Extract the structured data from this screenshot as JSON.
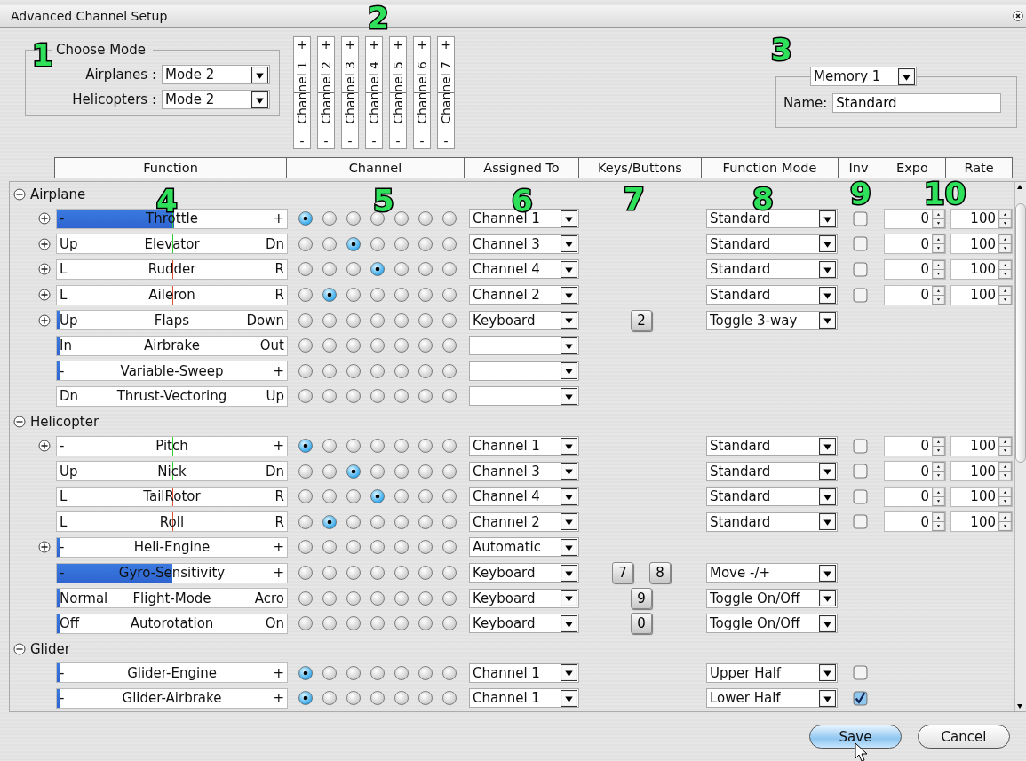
{
  "window": {
    "title": "Advanced Channel Setup"
  },
  "callouts": [
    "1",
    "2",
    "3",
    "4",
    "5",
    "6",
    "7",
    "8",
    "9",
    "10"
  ],
  "mode_group": {
    "legend": "Choose Mode",
    "fields": [
      {
        "label": "Airplanes :",
        "value": "Mode 2"
      },
      {
        "label": "Helicopters :",
        "value": "Mode 2"
      }
    ]
  },
  "channel_headers": [
    {
      "plus": "+",
      "label": "Channel 1",
      "minus": "-"
    },
    {
      "plus": "+",
      "label": "Channel 2",
      "minus": "-"
    },
    {
      "plus": "+",
      "label": "Channel 3",
      "minus": "-"
    },
    {
      "plus": "+",
      "label": "Channel 4",
      "minus": "-"
    },
    {
      "plus": "+",
      "label": "Channel 5",
      "minus": "-"
    },
    {
      "plus": "+",
      "label": "Channel 6",
      "minus": "-"
    },
    {
      "plus": "+",
      "label": "Channel 7",
      "minus": "-"
    }
  ],
  "memory": {
    "selector": "Memory 1",
    "name_label": "Name:",
    "name_value": "Standard"
  },
  "columns": [
    "Function",
    "Channel",
    "Assigned To",
    "Keys/Buttons",
    "Function Mode",
    "Inv",
    "Expo",
    "Rate"
  ],
  "sections": [
    {
      "label": "Airplane",
      "expanded": true,
      "rows": [
        {
          "expandable": true,
          "left": "-",
          "name": "Throttle",
          "right": "+",
          "level": 0.51,
          "color": "#33cc33",
          "channels": [
            {
              "selected": true
            },
            {
              "selected": false
            },
            {
              "selected": false
            },
            {
              "selected": false
            },
            {
              "selected": false
            },
            {
              "selected": false
            },
            {
              "selected": false
            }
          ],
          "assigned": "Channel 1",
          "mode": "Standard",
          "inverted": false,
          "expo": "0",
          "rate": "100"
        },
        {
          "expandable": true,
          "left": "Up",
          "name": "Elevator",
          "right": "Dn",
          "color": "#33cc33",
          "channels": [
            {
              "selected": false
            },
            {
              "selected": false
            },
            {
              "selected": true
            },
            {
              "selected": false
            },
            {
              "selected": false
            },
            {
              "selected": false
            },
            {
              "selected": false
            }
          ],
          "assigned": "Channel 3",
          "mode": "Standard",
          "inverted": false,
          "expo": "0",
          "rate": "100"
        },
        {
          "expandable": true,
          "left": "L",
          "name": "Rudder",
          "right": "R",
          "color": "#e05030",
          "channels": [
            {
              "selected": false
            },
            {
              "selected": false
            },
            {
              "selected": false
            },
            {
              "selected": true
            },
            {
              "selected": false
            },
            {
              "selected": false
            },
            {
              "selected": false
            }
          ],
          "assigned": "Channel 4",
          "mode": "Standard",
          "inverted": false,
          "expo": "0",
          "rate": "100"
        },
        {
          "expandable": true,
          "left": "L",
          "name": "Aileron",
          "right": "R",
          "color": "#e05030",
          "channels": [
            {
              "selected": false
            },
            {
              "selected": true
            },
            {
              "selected": false
            },
            {
              "selected": false
            },
            {
              "selected": false
            },
            {
              "selected": false
            },
            {
              "selected": false
            }
          ],
          "assigned": "Channel 2",
          "mode": "Standard",
          "inverted": false,
          "expo": "0",
          "rate": "100"
        },
        {
          "expandable": true,
          "left": "Up",
          "name": "Flaps",
          "right": "Down",
          "level": 0.01,
          "channels": [
            {
              "selected": false
            },
            {
              "selected": false
            },
            {
              "selected": false
            },
            {
              "selected": false
            },
            {
              "selected": false
            },
            {
              "selected": false
            },
            {
              "selected": false
            }
          ],
          "assigned": "Keyboard",
          "keys": [
            "2"
          ],
          "mode": "Toggle 3-way"
        },
        {
          "left": "In",
          "name": "Airbrake",
          "right": "Out",
          "level": 0.01,
          "channels": [
            {
              "selected": false
            },
            {
              "selected": false
            },
            {
              "selected": false
            },
            {
              "selected": false
            },
            {
              "selected": false
            },
            {
              "selected": false
            },
            {
              "selected": false
            }
          ]
        },
        {
          "left": "-",
          "name": "Variable-Sweep",
          "right": "+",
          "level": 0.01,
          "channels": [
            {
              "selected": false
            },
            {
              "selected": false
            },
            {
              "selected": false
            },
            {
              "selected": false
            },
            {
              "selected": false
            },
            {
              "selected": false
            },
            {
              "selected": false
            }
          ]
        },
        {
          "left": "Dn",
          "name": "Thrust-Vectoring",
          "right": "Up",
          "channels": [
            {
              "selected": false
            },
            {
              "selected": false
            },
            {
              "selected": false
            },
            {
              "selected": false
            },
            {
              "selected": false
            },
            {
              "selected": false
            },
            {
              "selected": false
            }
          ]
        }
      ]
    },
    {
      "label": "Helicopter",
      "expanded": true,
      "rows": [
        {
          "expandable": true,
          "left": "-",
          "name": "Pitch",
          "right": "+",
          "color": "#33cc33",
          "channels": [
            {
              "selected": true
            },
            {
              "selected": false
            },
            {
              "selected": false
            },
            {
              "selected": false
            },
            {
              "selected": false
            },
            {
              "selected": false
            },
            {
              "selected": false
            }
          ],
          "assigned": "Channel 1",
          "mode": "Standard",
          "inverted": false,
          "expo": "0",
          "rate": "100"
        },
        {
          "left": "Up",
          "name": "Nick",
          "right": "Dn",
          "color": "#33cc33",
          "channels": [
            {
              "selected": false
            },
            {
              "selected": false
            },
            {
              "selected": true
            },
            {
              "selected": false
            },
            {
              "selected": false
            },
            {
              "selected": false
            },
            {
              "selected": false
            }
          ],
          "assigned": "Channel 3",
          "mode": "Standard",
          "inverted": false,
          "expo": "0",
          "rate": "100"
        },
        {
          "left": "L",
          "name": "TailRotor",
          "right": "R",
          "color": "#e05030",
          "channels": [
            {
              "selected": false
            },
            {
              "selected": false
            },
            {
              "selected": false
            },
            {
              "selected": true
            },
            {
              "selected": false
            },
            {
              "selected": false
            },
            {
              "selected": false
            }
          ],
          "assigned": "Channel 4",
          "mode": "Standard",
          "inverted": false,
          "expo": "0",
          "rate": "100"
        },
        {
          "left": "L",
          "name": "Roll",
          "right": "R",
          "color": "#e05030",
          "channels": [
            {
              "selected": false
            },
            {
              "selected": true
            },
            {
              "selected": false
            },
            {
              "selected": false
            },
            {
              "selected": false
            },
            {
              "selected": false
            },
            {
              "selected": false
            }
          ],
          "assigned": "Channel 2",
          "mode": "Standard",
          "inverted": false,
          "expo": "0",
          "rate": "100"
        },
        {
          "expandable": true,
          "left": "-",
          "name": "Heli-Engine",
          "right": "+",
          "level": 0.01,
          "channels": [
            {
              "selected": false
            },
            {
              "selected": false
            },
            {
              "selected": false
            },
            {
              "selected": false
            },
            {
              "selected": false
            },
            {
              "selected": false
            },
            {
              "selected": false
            }
          ],
          "assigned": "Automatic"
        },
        {
          "left": "-",
          "name": "Gyro-Sensitivity",
          "right": "+",
          "level": 0.5,
          "channels": [
            {
              "selected": false
            },
            {
              "selected": false
            },
            {
              "selected": false
            },
            {
              "selected": false
            },
            {
              "selected": false
            },
            {
              "selected": false
            },
            {
              "selected": false
            }
          ],
          "assigned": "Keyboard",
          "keys": [
            "7",
            "8"
          ],
          "mode": "Move -/+"
        },
        {
          "left": "Normal",
          "name": "Flight-Mode",
          "right": "Acro",
          "level": 0.01,
          "channels": [
            {
              "selected": false
            },
            {
              "selected": false
            },
            {
              "selected": false
            },
            {
              "selected": false
            },
            {
              "selected": false
            },
            {
              "selected": false
            },
            {
              "selected": false
            }
          ],
          "assigned": "Keyboard",
          "keys": [
            "9"
          ],
          "mode": "Toggle On/Off"
        },
        {
          "left": "Off",
          "name": "Autorotation",
          "right": "On",
          "level": 0.01,
          "channels": [
            {
              "selected": false
            },
            {
              "selected": false
            },
            {
              "selected": false
            },
            {
              "selected": false
            },
            {
              "selected": false
            },
            {
              "selected": false
            },
            {
              "selected": false
            }
          ],
          "assigned": "Keyboard",
          "keys": [
            "0"
          ],
          "mode": "Toggle On/Off"
        }
      ]
    },
    {
      "label": "Glider",
      "expanded": true,
      "rows": [
        {
          "left": "-",
          "name": "Glider-Engine",
          "right": "+",
          "level": 0.01,
          "channels": [
            {
              "selected": true
            },
            {
              "selected": false
            },
            {
              "selected": false
            },
            {
              "selected": false
            },
            {
              "selected": false
            },
            {
              "selected": false
            },
            {
              "selected": false
            }
          ],
          "assigned": "Channel 1",
          "mode": "Upper Half",
          "inverted": false
        },
        {
          "left": "-",
          "name": "Glider-Airbrake",
          "right": "+",
          "level": 0.01,
          "channels": [
            {
              "selected": true
            },
            {
              "selected": false
            },
            {
              "selected": false
            },
            {
              "selected": false
            },
            {
              "selected": false
            },
            {
              "selected": false
            },
            {
              "selected": false
            }
          ],
          "assigned": "Channel 1",
          "mode": "Lower Half",
          "inverted": true
        }
      ]
    }
  ],
  "buttons": [
    {
      "label": "Save",
      "kind": "default"
    },
    {
      "label": "Cancel",
      "kind": "normal"
    }
  ]
}
